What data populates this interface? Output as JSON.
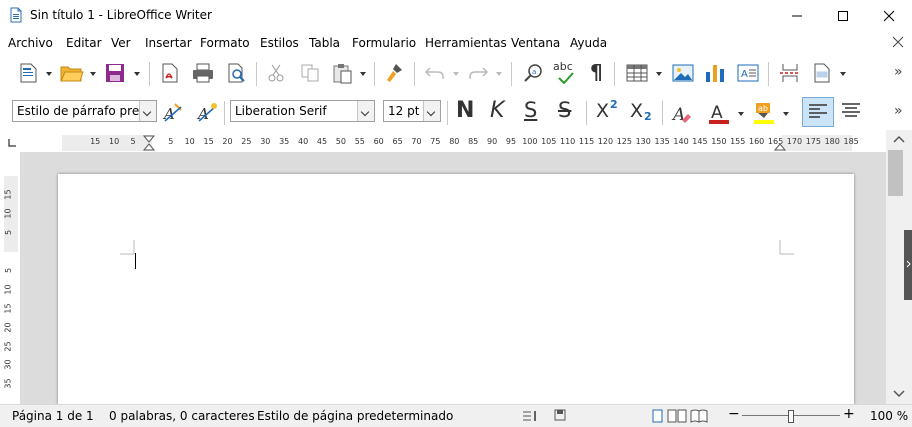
{
  "window": {
    "title": "Sin título 1 - LibreOffice Writer"
  },
  "menu": [
    "Archivo",
    "Editar",
    "Ver",
    "Insertar",
    "Formato",
    "Estilos",
    "Tabla",
    "Formulario",
    "Herramientas",
    "Ventana",
    "Ayuda"
  ],
  "format_bar": {
    "paragraph_style": "Estilo de párrafo predet",
    "font_name": "Liberation Serif",
    "font_size": "12 pt",
    "bold_label": "N",
    "italic_label": "K",
    "underline_label": "S",
    "strike_label": "S",
    "superscript_label": "X",
    "superscript_mark": "2",
    "subscript_label": "X",
    "subscript_mark": "2"
  },
  "standard_bar": {
    "spelling_label": "abc",
    "formatting_marks_label": "¶"
  },
  "ruler": {
    "horizontal": [
      "15",
      "10",
      "5",
      "5",
      "10",
      "15",
      "20",
      "25",
      "30",
      "35",
      "40",
      "45",
      "50",
      "55",
      "60",
      "65",
      "70",
      "75",
      "80",
      "85",
      "90",
      "95",
      "100",
      "105",
      "110",
      "115",
      "120",
      "125",
      "130",
      "135",
      "140",
      "145",
      "150",
      "155",
      "160",
      "165",
      "170",
      "175",
      "180",
      "185"
    ],
    "vertical": [
      "15",
      "10",
      "5",
      "5",
      "10",
      "15",
      "20",
      "25",
      "30",
      "35"
    ]
  },
  "status_bar": {
    "page": "Página 1 de 1",
    "words": "0 palabras, 0 caracteres",
    "page_style": "Estilo de página predeterminado",
    "zoom": "100 %"
  },
  "colors": {
    "font_color": "#c9211e",
    "highlight_color": "#ffff00",
    "accent_blue": "#1e6bb8"
  }
}
